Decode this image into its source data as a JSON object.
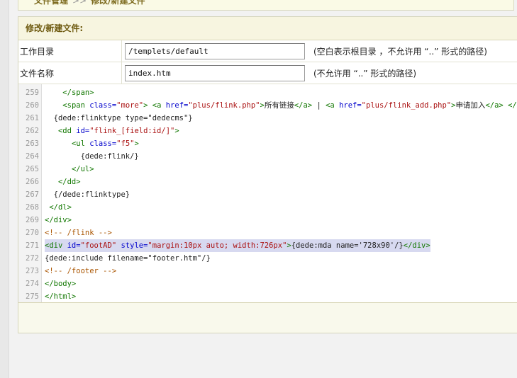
{
  "breadcrumb": {
    "items": [
      "文件管理",
      "修改/新建文件"
    ],
    "separator": ">>"
  },
  "panel": {
    "title": "修改/新建文件:"
  },
  "form": {
    "workdir": {
      "label": "工作目录",
      "value": "/templets/default",
      "hint": "(空白表示根目录 ，不允许用 “..” 形式的路径)"
    },
    "filename": {
      "label": "文件名称",
      "value": "index.htm",
      "hint": "(不允许用 “..” 形式的路径)"
    }
  },
  "editor": {
    "highlight_line": 271,
    "lines": [
      {
        "n": "259",
        "tokens": [
          [
            "",
            "    "
          ],
          [
            "t",
            "</span>"
          ]
        ]
      },
      {
        "n": "260",
        "tokens": [
          [
            "",
            "    "
          ],
          [
            "t",
            "<span "
          ],
          [
            "a",
            "class="
          ],
          [
            "s",
            "\"more\""
          ],
          [
            "t",
            ">"
          ],
          [
            "",
            " "
          ],
          [
            "t",
            "<a "
          ],
          [
            "a",
            "href="
          ],
          [
            "s",
            "\"plus/flink.php\""
          ],
          [
            "t",
            ">"
          ],
          [
            "",
            "所有链接"
          ],
          [
            "t",
            "</a>"
          ],
          [
            "",
            " | "
          ],
          [
            "t",
            "<a "
          ],
          [
            "a",
            "href="
          ],
          [
            "s",
            "\"plus/flink_add.php\""
          ],
          [
            "t",
            ">"
          ],
          [
            "",
            "申请加入"
          ],
          [
            "t",
            "</a>"
          ],
          [
            "",
            " "
          ],
          [
            "t",
            "</span>"
          ]
        ]
      },
      {
        "n": "261",
        "tokens": [
          [
            "",
            "  {dede:flinktype type=\"dedecms\"}"
          ]
        ]
      },
      {
        "n": "262",
        "tokens": [
          [
            "",
            "   "
          ],
          [
            "t",
            "<dd "
          ],
          [
            "a",
            "id="
          ],
          [
            "s",
            "\"flink_[field:id/]\""
          ],
          [
            "t",
            ">"
          ]
        ]
      },
      {
        "n": "263",
        "tokens": [
          [
            "",
            "      "
          ],
          [
            "t",
            "<ul "
          ],
          [
            "a",
            "class="
          ],
          [
            "s",
            "\"f5\""
          ],
          [
            "t",
            ">"
          ]
        ]
      },
      {
        "n": "264",
        "tokens": [
          [
            "",
            "        {dede:flink/}"
          ]
        ]
      },
      {
        "n": "265",
        "tokens": [
          [
            "",
            "      "
          ],
          [
            "t",
            "</ul>"
          ]
        ]
      },
      {
        "n": "266",
        "tokens": [
          [
            "",
            "   "
          ],
          [
            "t",
            "</dd>"
          ]
        ]
      },
      {
        "n": "267",
        "tokens": [
          [
            "",
            "  {/dede:flinktype}"
          ]
        ]
      },
      {
        "n": "268",
        "tokens": [
          [
            "",
            " "
          ],
          [
            "t",
            "</dl>"
          ]
        ]
      },
      {
        "n": "269",
        "tokens": [
          [
            "t",
            "</div>"
          ]
        ]
      },
      {
        "n": "270",
        "tokens": [
          [
            "c",
            "<!-- /flink -->"
          ]
        ]
      },
      {
        "n": "271",
        "tokens": [
          [
            "t",
            "<div "
          ],
          [
            "a",
            "id="
          ],
          [
            "s",
            "\"footAD\""
          ],
          [
            "",
            " "
          ],
          [
            "a",
            "style="
          ],
          [
            "s",
            "\"margin:10px auto; width:726px\""
          ],
          [
            "t",
            ">"
          ],
          [
            "",
            "{dede:mda name='728x90'/}"
          ],
          [
            "t",
            "</div>"
          ]
        ]
      },
      {
        "n": "272",
        "tokens": [
          [
            "",
            "{dede:include filename=\"footer.htm\"/}"
          ]
        ]
      },
      {
        "n": "273",
        "tokens": [
          [
            "c",
            "<!-- /footer -->"
          ]
        ]
      },
      {
        "n": "274",
        "tokens": [
          [
            "t",
            "</body>"
          ]
        ]
      },
      {
        "n": "275",
        "tokens": [
          [
            "t",
            "</html>"
          ]
        ]
      }
    ]
  }
}
